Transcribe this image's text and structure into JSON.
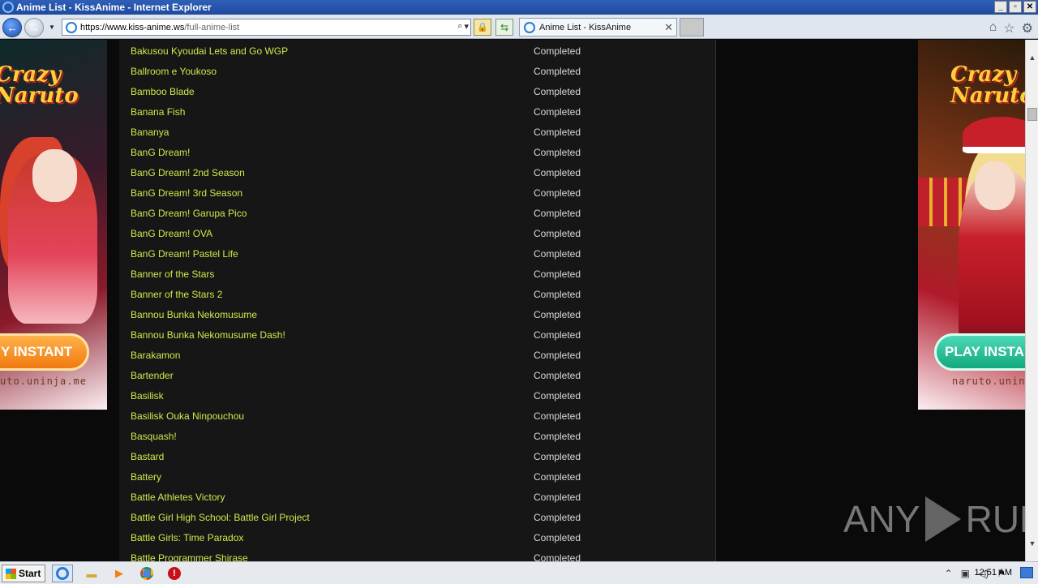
{
  "window": {
    "title": "Anime List - KissAnime - Internet Explorer",
    "controls": [
      "_",
      "▫",
      "✕"
    ]
  },
  "navbar": {
    "back_icon": "←",
    "forward_icon": "→",
    "address_host": "https://www.kiss-anime.ws",
    "address_path": "/full-anime-list",
    "tab_title": "Anime List - KissAnime",
    "tab_close": "✕"
  },
  "ads": {
    "brand": "Crazy Naruto",
    "left_button": "Y INSTANT",
    "right_button": "PLAY INSTA",
    "left_url": "uto.uninja.me",
    "right_url": "naruto.uninja"
  },
  "anime_list": [
    {
      "title": "Bakusou Kyoudai Lets and Go WGP",
      "status": "Completed"
    },
    {
      "title": "Ballroom e Youkoso",
      "status": "Completed"
    },
    {
      "title": "Bamboo Blade",
      "status": "Completed"
    },
    {
      "title": "Banana Fish",
      "status": "Completed"
    },
    {
      "title": "Bananya",
      "status": "Completed"
    },
    {
      "title": "BanG Dream!",
      "status": "Completed"
    },
    {
      "title": "BanG Dream! 2nd Season",
      "status": "Completed"
    },
    {
      "title": "BanG Dream! 3rd Season",
      "status": "Completed"
    },
    {
      "title": "BanG Dream! Garupa Pico",
      "status": "Completed"
    },
    {
      "title": "BanG Dream! OVA",
      "status": "Completed"
    },
    {
      "title": "BanG Dream! Pastel Life",
      "status": "Completed"
    },
    {
      "title": "Banner of the Stars",
      "status": "Completed"
    },
    {
      "title": "Banner of the Stars 2",
      "status": "Completed"
    },
    {
      "title": "Bannou Bunka Nekomusume",
      "status": "Completed"
    },
    {
      "title": "Bannou Bunka Nekomusume Dash!",
      "status": "Completed"
    },
    {
      "title": "Barakamon",
      "status": "Completed"
    },
    {
      "title": "Bartender",
      "status": "Completed"
    },
    {
      "title": "Basilisk",
      "status": "Completed"
    },
    {
      "title": "Basilisk Ouka Ninpouchou",
      "status": "Completed"
    },
    {
      "title": "Basquash!",
      "status": "Completed"
    },
    {
      "title": "Bastard",
      "status": "Completed"
    },
    {
      "title": "Battery",
      "status": "Completed"
    },
    {
      "title": "Battle Athletes Victory",
      "status": "Completed"
    },
    {
      "title": "Battle Girl High School: Battle Girl Project",
      "status": "Completed"
    },
    {
      "title": "Battle Girls: Time Paradox",
      "status": "Completed"
    },
    {
      "title": "Battle Programmer Shirase",
      "status": "Completed"
    }
  ],
  "watermark": {
    "left": "ANY",
    "right": "RUN"
  },
  "taskbar": {
    "start_label": "Start",
    "clock": "12:51 AM"
  }
}
